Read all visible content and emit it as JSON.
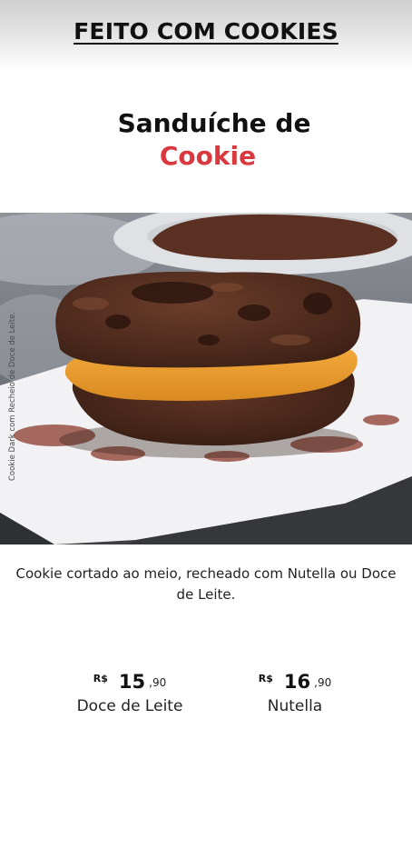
{
  "header": {
    "brand": "FEITO COM COOKIES"
  },
  "product": {
    "title_line1": "Sanduíche de",
    "title_line2": "Cookie",
    "image_caption": "Cookie Dark com Recheio de Doce de Leite.",
    "description": "Cookie cortado ao meio, recheado com Nutella ou Doce de Leite."
  },
  "prices": [
    {
      "currency": "R$",
      "integer": "15",
      "cents": ",90",
      "name": "Doce de Leite"
    },
    {
      "currency": "R$",
      "integer": "16",
      "cents": ",90",
      "name": "Nutella"
    }
  ],
  "colors": {
    "accent": "#d9383e",
    "text": "#222222"
  }
}
